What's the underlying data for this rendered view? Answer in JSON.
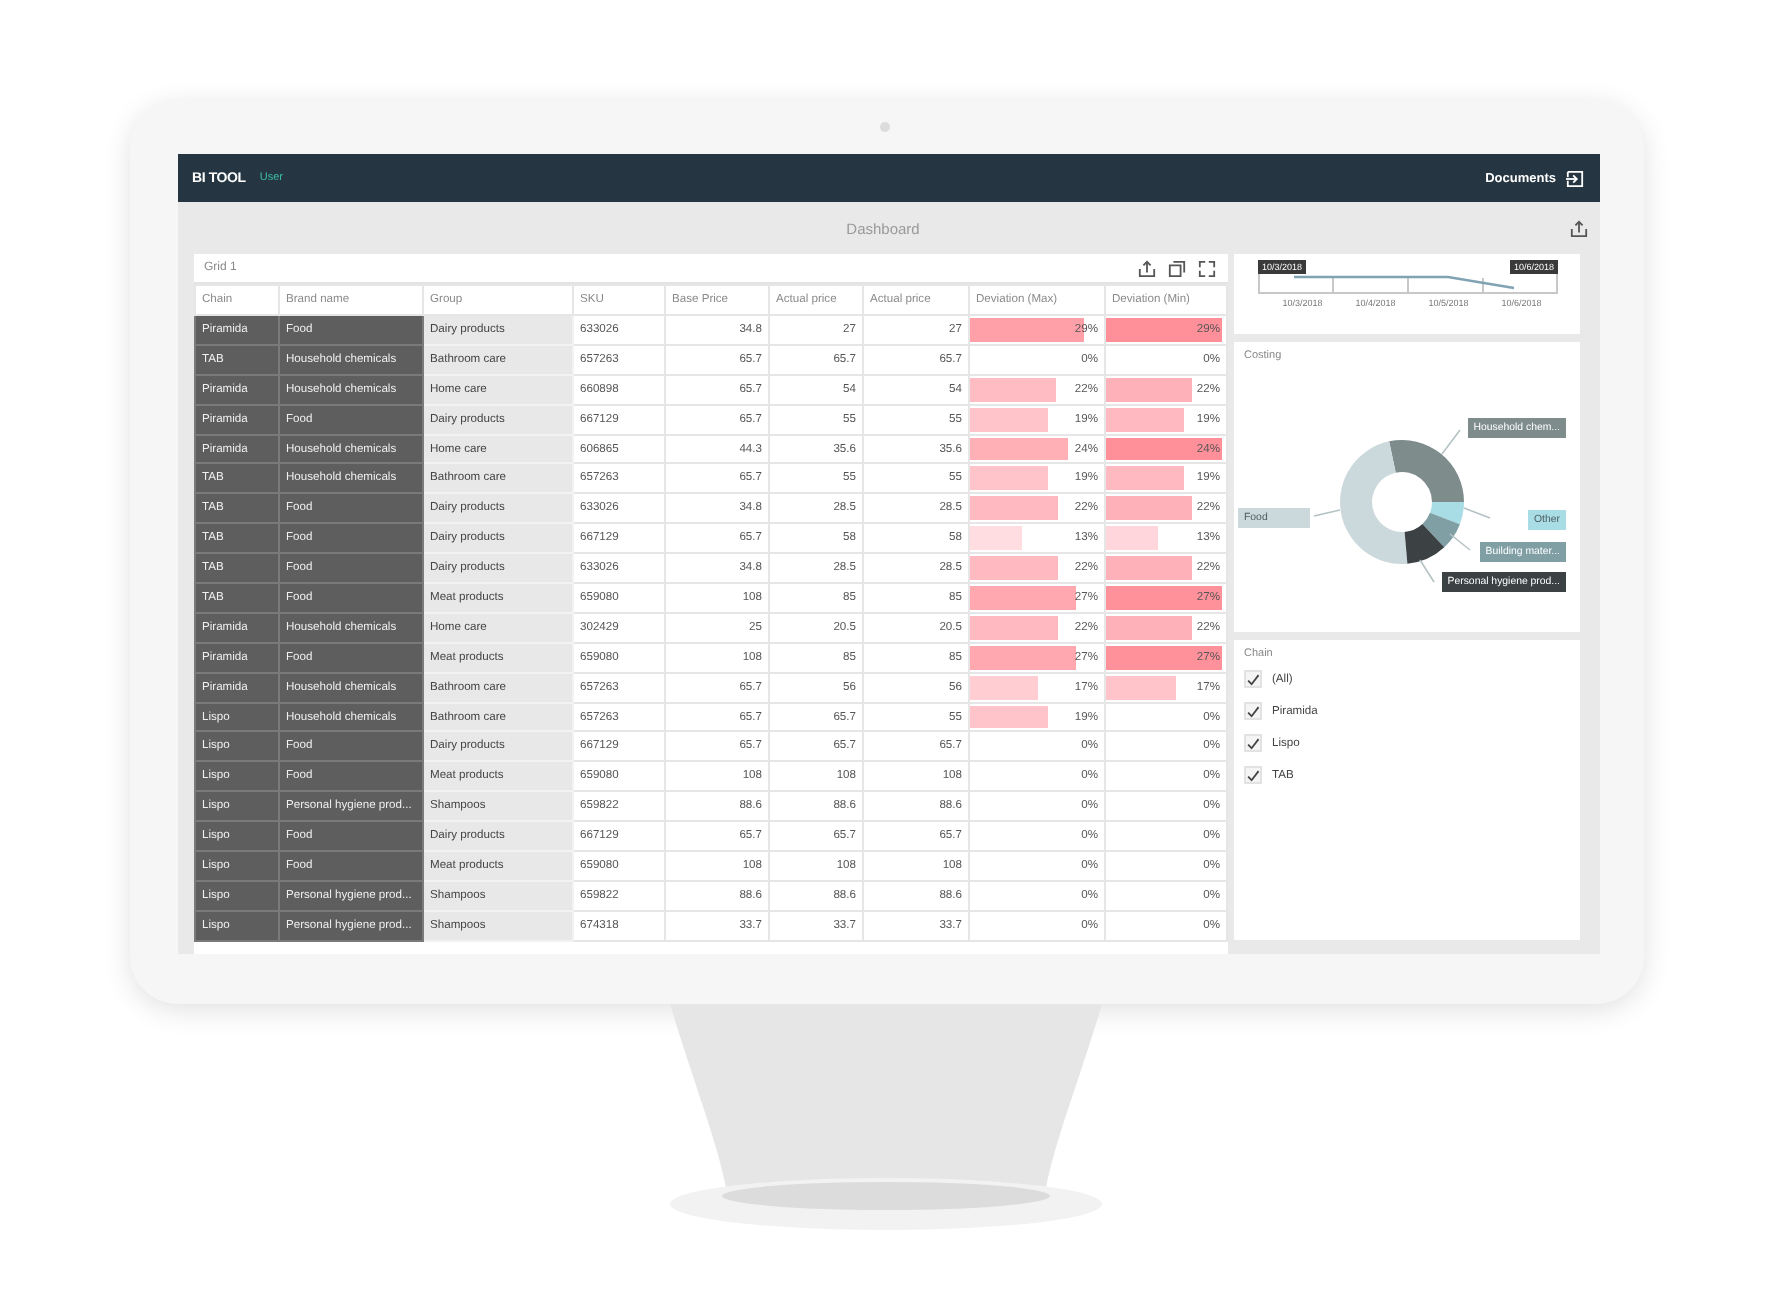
{
  "app": {
    "title": "BI TOOL",
    "user": "User",
    "documents": "Documents"
  },
  "dashboard": {
    "title": "Dashboard"
  },
  "grid": {
    "title": "Grid 1",
    "columns": [
      "Chain",
      "Brand name",
      "Group",
      "SKU",
      "Base Price",
      "Actual price",
      "Actual price",
      "Deviation (Max)",
      "Deviation (Min)"
    ],
    "rows": [
      {
        "cells": [
          "Piramida",
          "Food",
          "Dairy products",
          "633026",
          "34.8",
          "27",
          "27"
        ],
        "deviation_max": {
          "value": "29%",
          "level": 0.85
        },
        "deviation_min": {
          "value": "29%",
          "level": 0.97
        }
      },
      {
        "cells": [
          "TAB",
          "Household chemicals",
          "Bathroom care",
          "657263",
          "65.7",
          "65.7",
          "65.7"
        ],
        "deviation_max": {
          "value": "0%"
        },
        "deviation_min": {
          "value": "0%"
        }
      },
      {
        "cells": [
          "Piramida",
          "Household chemicals",
          "Home care",
          "660898",
          "65.7",
          "54",
          "54"
        ],
        "deviation_max": {
          "value": "22%",
          "level": 0.64
        },
        "deviation_min": {
          "value": "22%",
          "level": 0.72
        }
      },
      {
        "cells": [
          "Piramida",
          "Food",
          "Dairy products",
          "667129",
          "65.7",
          "55",
          "55"
        ],
        "deviation_max": {
          "value": "19%",
          "level": 0.58
        },
        "deviation_min": {
          "value": "19%",
          "level": 0.65
        }
      },
      {
        "cells": [
          "Piramida",
          "Household chemicals",
          "Home care",
          "606865",
          "44.3",
          "35.6",
          "35.6"
        ],
        "deviation_max": {
          "value": "24%",
          "level": 0.73
        },
        "deviation_min": {
          "value": "24%",
          "level": 0.97
        }
      },
      {
        "cells": [
          "TAB",
          "Household chemicals",
          "Bathroom care",
          "657263",
          "65.7",
          "55",
          "55"
        ],
        "deviation_max": {
          "value": "19%",
          "level": 0.58
        },
        "deviation_min": {
          "value": "19%",
          "level": 0.65
        }
      },
      {
        "cells": [
          "TAB",
          "Food",
          "Dairy products",
          "633026",
          "34.8",
          "28.5",
          "28.5"
        ],
        "deviation_max": {
          "value": "22%",
          "level": 0.66
        },
        "deviation_min": {
          "value": "22%",
          "level": 0.72
        }
      },
      {
        "cells": [
          "TAB",
          "Food",
          "Dairy products",
          "667129",
          "65.7",
          "58",
          "58"
        ],
        "deviation_max": {
          "value": "13%",
          "level": 0.39
        },
        "deviation_min": {
          "value": "13%",
          "level": 0.44
        }
      },
      {
        "cells": [
          "TAB",
          "Food",
          "Dairy products",
          "633026",
          "34.8",
          "28.5",
          "28.5"
        ],
        "deviation_max": {
          "value": "22%",
          "level": 0.66
        },
        "deviation_min": {
          "value": "22%",
          "level": 0.72
        }
      },
      {
        "cells": [
          "TAB",
          "Food",
          "Meat products",
          "659080",
          "108",
          "85",
          "85"
        ],
        "deviation_max": {
          "value": "27%",
          "level": 0.79
        },
        "deviation_min": {
          "value": "27%",
          "level": 0.96
        }
      },
      {
        "cells": [
          "Piramida",
          "Household chemicals",
          "Home care",
          "302429",
          "25",
          "20.5",
          "20.5"
        ],
        "deviation_max": {
          "value": "22%",
          "level": 0.65
        },
        "deviation_min": {
          "value": "22%",
          "level": 0.72
        }
      },
      {
        "cells": [
          "Piramida",
          "Food",
          "Meat products",
          "659080",
          "108",
          "85",
          "85"
        ],
        "deviation_max": {
          "value": "27%",
          "level": 0.79
        },
        "deviation_min": {
          "value": "27%",
          "level": 0.96
        }
      },
      {
        "cells": [
          "Piramida",
          "Household chemicals",
          "Bathroom care",
          "657263",
          "65.7",
          "56",
          "56"
        ],
        "deviation_max": {
          "value": "17%",
          "level": 0.51
        },
        "deviation_min": {
          "value": "17%",
          "level": 0.58
        }
      },
      {
        "cells": [
          "Lispo",
          "Household chemicals",
          "Bathroom care",
          "657263",
          "65.7",
          "65.7",
          "55"
        ],
        "deviation_max": {
          "value": "19%",
          "level": 0.58
        },
        "deviation_min": {
          "value": "0%"
        }
      },
      {
        "cells": [
          "Lispo",
          "Food",
          "Dairy products",
          "667129",
          "65.7",
          "65.7",
          "65.7"
        ],
        "deviation_max": {
          "value": "0%"
        },
        "deviation_min": {
          "value": "0%"
        }
      },
      {
        "cells": [
          "Lispo",
          "Food",
          "Meat products",
          "659080",
          "108",
          "108",
          "108"
        ],
        "deviation_max": {
          "value": "0%"
        },
        "deviation_min": {
          "value": "0%"
        }
      },
      {
        "cells": [
          "Lispo",
          "Personal hygiene prod...",
          "Shampoos",
          "659822",
          "88.6",
          "88.6",
          "88.6"
        ],
        "deviation_max": {
          "value": "0%"
        },
        "deviation_min": {
          "value": "0%"
        }
      },
      {
        "cells": [
          "Lispo",
          "Food",
          "Dairy products",
          "667129",
          "65.7",
          "65.7",
          "65.7"
        ],
        "deviation_max": {
          "value": "0%"
        },
        "deviation_min": {
          "value": "0%"
        }
      },
      {
        "cells": [
          "Lispo",
          "Food",
          "Meat products",
          "659080",
          "108",
          "108",
          "108"
        ],
        "deviation_max": {
          "value": "0%"
        },
        "deviation_min": {
          "value": "0%"
        }
      },
      {
        "cells": [
          "Lispo",
          "Personal hygiene prod...",
          "Shampoos",
          "659822",
          "88.6",
          "88.6",
          "88.6"
        ],
        "deviation_max": {
          "value": "0%"
        },
        "deviation_min": {
          "value": "0%"
        }
      },
      {
        "cells": [
          "Lispo",
          "Personal hygiene prod...",
          "Shampoos",
          "674318",
          "33.7",
          "33.7",
          "33.7"
        ],
        "deviation_max": {
          "value": "0%"
        },
        "deviation_min": {
          "value": "0%"
        }
      }
    ]
  },
  "timeline": {
    "range_start": "10/3/2018",
    "range_end": "10/6/2018",
    "dates": [
      "10/3/2018",
      "10/4/2018",
      "10/5/2018",
      "10/6/2018"
    ]
  },
  "costing": {
    "title": "Costing",
    "segments": [
      {
        "label": "Household chem...",
        "color": "#7e8c8c"
      },
      {
        "label": "Food",
        "color": "#cbd9dd"
      },
      {
        "label": "Other",
        "color": "#a9dde6"
      },
      {
        "label": "Building mater...",
        "color": "#7f9fa5"
      },
      {
        "label": "Personal hygiene prod...",
        "color": "#3c4244"
      }
    ]
  },
  "chain_filter": {
    "title": "Chain",
    "options": [
      {
        "label": "(All)",
        "checked": true
      },
      {
        "label": "Piramida",
        "checked": true
      },
      {
        "label": "Lispo",
        "checked": true
      },
      {
        "label": "TAB",
        "checked": true
      }
    ]
  }
}
